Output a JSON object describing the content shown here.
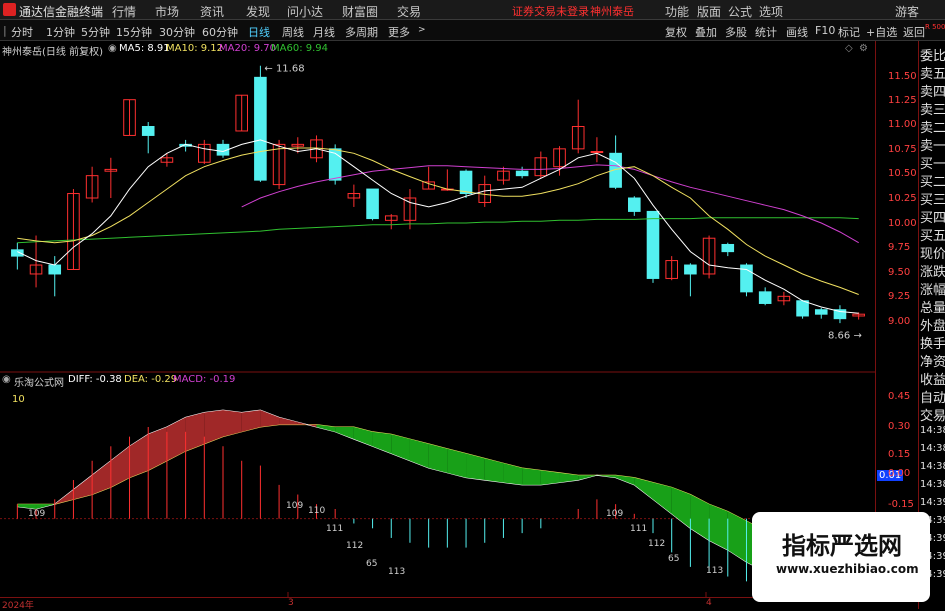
{
  "titlebar": {
    "app_title": "通达信金融终端",
    "menu": [
      "行情",
      "市场",
      "资讯",
      "发现",
      "问小达",
      "财富圈",
      "交易"
    ],
    "login_notice": "证券交易未登录",
    "stock_name": "神州泰岳",
    "right_menu": [
      "功能",
      "版面",
      "公式",
      "选项",
      "游客"
    ]
  },
  "toolbar": {
    "periods": [
      "分时",
      "1分钟",
      "5分钟",
      "15分钟",
      "30分钟",
      "60分钟",
      "日线",
      "周线",
      "月线",
      "多周期",
      "更多"
    ],
    "active_period": "日线",
    "tools": [
      "复权",
      "叠加",
      "多股",
      "统计",
      "画线",
      "F10",
      "标记",
      "+自选",
      "返回"
    ]
  },
  "main_chart": {
    "title": "神州泰岳(日线 前复权)",
    "ma5": "MA5: 8.91",
    "ma10": "MA10: 9.12",
    "ma20": "MA20: 9.70",
    "ma60": "MA60: 9.94",
    "high_label": "11.68",
    "low_label": "8.66",
    "y_ticks": [
      "11.50",
      "11.25",
      "11.00",
      "10.75",
      "10.50",
      "10.25",
      "10.00",
      "9.75",
      "9.50",
      "9.25",
      "9.00"
    ]
  },
  "macd_chart": {
    "title": "乐淘公式网",
    "diff": "DIFF: -0.38",
    "dea": "DEA: -0.29",
    "macd": "MACD: -0.19",
    "marker_10": "10",
    "y_ticks": [
      "0.45",
      "0.30",
      "0.15",
      "0.00",
      "-0.15"
    ],
    "current_value": "0.01",
    "labels": [
      "109",
      "109",
      "110",
      "111",
      "112",
      "65",
      "113",
      "109",
      "111",
      "112",
      "65",
      "113"
    ]
  },
  "right_panel": {
    "top_label": "R 500",
    "items": [
      "委比",
      "卖五",
      "卖四",
      "卖三",
      "卖二",
      "卖一",
      "买一",
      "买二",
      "买三",
      "买四",
      "买五",
      "现价",
      "涨跌",
      "涨幅",
      "总量",
      "外盘",
      "换手",
      "净资",
      "收益",
      "自动",
      "交易",
      "14:38",
      "14:38",
      "14:38",
      "14:38",
      "14:39",
      "14:39",
      "14:39",
      "14:39",
      "14:39"
    ]
  },
  "bottom_axis": {
    "labels": [
      "2024年",
      "3",
      "4"
    ]
  },
  "watermark": {
    "title": "指标严选网",
    "url": "www.xuezhibiao.com"
  },
  "colors": {
    "up": "#ff3030",
    "down": "#54f0f0",
    "ma5": "#ffffff",
    "ma10": "#f0e060",
    "ma20": "#d040d0",
    "ma60": "#30c030",
    "macd_red_fill": "#a02828",
    "macd_green_fill": "#18a018"
  },
  "chart_data": {
    "type": "candlestick",
    "candles": [
      {
        "o": 9.62,
        "c": 9.55,
        "h": 9.7,
        "l": 9.4
      },
      {
        "o": 9.35,
        "c": 9.45,
        "h": 9.78,
        "l": 9.2
      },
      {
        "o": 9.45,
        "c": 9.35,
        "h": 9.55,
        "l": 9.1
      },
      {
        "o": 9.4,
        "c": 10.25,
        "h": 10.3,
        "l": 9.4
      },
      {
        "o": 10.2,
        "c": 10.45,
        "h": 10.55,
        "l": 10.15
      },
      {
        "o": 10.5,
        "c": 10.52,
        "h": 10.65,
        "l": 10.2
      },
      {
        "o": 10.9,
        "c": 11.3,
        "h": 11.3,
        "l": 10.9
      },
      {
        "o": 11.0,
        "c": 10.9,
        "h": 11.05,
        "l": 10.7
      },
      {
        "o": 10.6,
        "c": 10.65,
        "h": 10.7,
        "l": 10.55
      },
      {
        "o": 10.8,
        "c": 10.78,
        "h": 10.85,
        "l": 10.72
      },
      {
        "o": 10.6,
        "c": 10.8,
        "h": 10.85,
        "l": 10.58
      },
      {
        "o": 10.8,
        "c": 10.68,
        "h": 10.85,
        "l": 10.65
      },
      {
        "o": 10.95,
        "c": 11.35,
        "h": 11.35,
        "l": 10.95
      },
      {
        "o": 11.55,
        "c": 10.4,
        "h": 11.68,
        "l": 10.38
      },
      {
        "o": 10.35,
        "c": 10.8,
        "h": 10.85,
        "l": 10.3
      },
      {
        "o": 10.78,
        "c": 10.8,
        "h": 10.88,
        "l": 10.7
      },
      {
        "o": 10.65,
        "c": 10.85,
        "h": 10.9,
        "l": 10.6
      },
      {
        "o": 10.75,
        "c": 10.4,
        "h": 10.8,
        "l": 10.35
      },
      {
        "o": 10.2,
        "c": 10.25,
        "h": 10.35,
        "l": 10.1
      },
      {
        "o": 10.3,
        "c": 9.97,
        "h": 10.3,
        "l": 9.95
      },
      {
        "o": 9.95,
        "c": 10.0,
        "h": 10.02,
        "l": 9.85
      },
      {
        "o": 9.95,
        "c": 10.2,
        "h": 10.3,
        "l": 9.85
      },
      {
        "o": 10.3,
        "c": 10.38,
        "h": 10.55,
        "l": 10.3
      },
      {
        "o": 10.3,
        "c": 10.3,
        "h": 10.52,
        "l": 10.28
      },
      {
        "o": 10.5,
        "c": 10.25,
        "h": 10.52,
        "l": 10.2
      },
      {
        "o": 10.15,
        "c": 10.35,
        "h": 10.45,
        "l": 10.1
      },
      {
        "o": 10.4,
        "c": 10.5,
        "h": 10.55,
        "l": 10.35
      },
      {
        "o": 10.5,
        "c": 10.45,
        "h": 10.55,
        "l": 10.42
      },
      {
        "o": 10.45,
        "c": 10.65,
        "h": 10.72,
        "l": 10.42
      },
      {
        "o": 10.55,
        "c": 10.75,
        "h": 10.78,
        "l": 10.45
      },
      {
        "o": 10.75,
        "c": 11.0,
        "h": 11.3,
        "l": 10.7
      },
      {
        "o": 10.72,
        "c": 10.72,
        "h": 10.88,
        "l": 10.6
      },
      {
        "o": 10.7,
        "c": 10.32,
        "h": 10.9,
        "l": 10.3
      },
      {
        "o": 10.2,
        "c": 10.05,
        "h": 10.22,
        "l": 10.0
      },
      {
        "o": 10.05,
        "c": 9.3,
        "h": 10.05,
        "l": 9.25
      },
      {
        "o": 9.3,
        "c": 9.5,
        "h": 9.55,
        "l": 9.28
      },
      {
        "o": 9.45,
        "c": 9.35,
        "h": 9.47,
        "l": 9.1
      },
      {
        "o": 9.35,
        "c": 9.75,
        "h": 9.78,
        "l": 9.3
      },
      {
        "o": 9.68,
        "c": 9.6,
        "h": 9.7,
        "l": 9.55
      },
      {
        "o": 9.45,
        "c": 9.15,
        "h": 9.47,
        "l": 9.1
      },
      {
        "o": 9.15,
        "c": 9.02,
        "h": 9.2,
        "l": 9.0
      },
      {
        "o": 9.05,
        "c": 9.1,
        "h": 9.15,
        "l": 9.0
      },
      {
        "o": 9.05,
        "c": 8.88,
        "h": 9.06,
        "l": 8.85
      },
      {
        "o": 8.95,
        "c": 8.9,
        "h": 8.97,
        "l": 8.85
      },
      {
        "o": 8.95,
        "c": 8.85,
        "h": 9.0,
        "l": 8.8
      },
      {
        "o": 8.88,
        "c": 8.9,
        "h": 8.92,
        "l": 8.84
      }
    ],
    "ma5": [
      9.6,
      9.5,
      9.45,
      9.65,
      9.8,
      10.0,
      10.3,
      10.55,
      10.7,
      10.8,
      10.75,
      10.72,
      10.8,
      10.85,
      10.78,
      10.72,
      10.75,
      10.7,
      10.55,
      10.4,
      10.25,
      10.15,
      10.1,
      10.15,
      10.22,
      10.28,
      10.3,
      10.32,
      10.42,
      10.52,
      10.65,
      10.7,
      10.6,
      10.42,
      10.12,
      9.85,
      9.6,
      9.45,
      9.42,
      9.4,
      9.28,
      9.18,
      9.05,
      8.98,
      8.93,
      8.91
    ],
    "ma10": [
      9.75,
      9.72,
      9.7,
      9.72,
      9.78,
      9.88,
      10.0,
      10.15,
      10.3,
      10.45,
      10.55,
      10.62,
      10.68,
      10.72,
      10.75,
      10.76,
      10.76,
      10.74,
      10.7,
      10.62,
      10.52,
      10.44,
      10.36,
      10.3,
      10.27,
      10.24,
      10.22,
      10.22,
      10.25,
      10.3,
      10.36,
      10.45,
      10.52,
      10.55,
      10.45,
      10.32,
      10.2,
      10.0,
      9.85,
      9.68,
      9.55,
      9.45,
      9.35,
      9.27,
      9.2,
      9.12
    ],
    "ma20": [
      null,
      null,
      null,
      null,
      null,
      null,
      null,
      null,
      null,
      null,
      null,
      null,
      10.1,
      10.2,
      10.27,
      10.33,
      10.38,
      10.42,
      10.46,
      10.5,
      10.52,
      10.54,
      10.56,
      10.56,
      10.55,
      10.54,
      10.53,
      10.52,
      10.52,
      10.53,
      10.55,
      10.57,
      10.56,
      10.52,
      10.45,
      10.38,
      10.32,
      10.27,
      10.22,
      10.17,
      10.12,
      10.07,
      10.0,
      9.92,
      9.82,
      9.7
    ],
    "ma60": [
      9.7,
      9.71,
      9.72,
      9.73,
      9.74,
      9.75,
      9.76,
      9.77,
      9.78,
      9.79,
      9.8,
      9.81,
      9.82,
      9.83,
      9.85,
      9.86,
      9.87,
      9.88,
      9.89,
      9.9,
      9.9,
      9.91,
      9.91,
      9.92,
      9.92,
      9.93,
      9.93,
      9.94,
      9.94,
      9.95,
      9.95,
      9.96,
      9.96,
      9.96,
      9.97,
      9.97,
      9.97,
      9.98,
      9.98,
      9.98,
      9.98,
      9.98,
      9.98,
      9.98,
      9.98,
      9.97
    ],
    "macd_diff": [
      0.05,
      0.04,
      0.06,
      0.12,
      0.18,
      0.24,
      0.3,
      0.35,
      0.38,
      0.42,
      0.44,
      0.45,
      0.44,
      0.45,
      0.42,
      0.4,
      0.38,
      0.36,
      0.33,
      0.3,
      0.27,
      0.24,
      0.21,
      0.19,
      0.17,
      0.16,
      0.15,
      0.14,
      0.14,
      0.15,
      0.16,
      0.18,
      0.17,
      0.14,
      0.08,
      0.02,
      -0.04,
      -0.09,
      -0.13,
      -0.18,
      -0.22,
      -0.26,
      -0.3,
      -0.33,
      -0.36,
      -0.38
    ],
    "macd_dea": [
      0.06,
      0.06,
      0.06,
      0.08,
      0.1,
      0.13,
      0.17,
      0.2,
      0.24,
      0.28,
      0.31,
      0.34,
      0.36,
      0.38,
      0.39,
      0.39,
      0.39,
      0.38,
      0.38,
      0.36,
      0.35,
      0.33,
      0.31,
      0.29,
      0.27,
      0.25,
      0.23,
      0.21,
      0.2,
      0.19,
      0.18,
      0.18,
      0.18,
      0.17,
      0.15,
      0.13,
      0.1,
      0.06,
      0.03,
      -0.01,
      -0.05,
      -0.09,
      -0.13,
      -0.18,
      -0.23,
      -0.29
    ],
    "ylim": [
      8.6,
      11.8
    ],
    "macd_ylim": [
      -0.3,
      0.55
    ]
  }
}
